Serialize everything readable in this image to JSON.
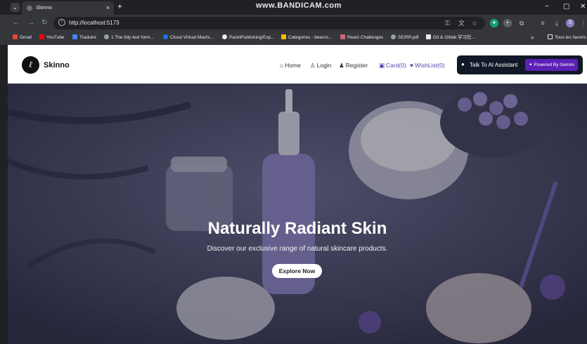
{
  "browser": {
    "tab_title": "Skinno",
    "tab_close": "×",
    "new_tab": "+",
    "watermark": "www.BANDICAM.com",
    "url": "http://localhost:5173",
    "window_controls": [
      "−",
      "▢",
      "✕"
    ],
    "bookmarks": [
      {
        "label": "Gmail",
        "icon": "gmail-icon",
        "color": "#ea4335"
      },
      {
        "label": "YouTube",
        "icon": "youtube-icon",
        "color": "#ff0000"
      },
      {
        "label": "Traduire",
        "icon": "translate-icon",
        "color": "#4285f4"
      },
      {
        "label": "1 The tidy text form...",
        "icon": "globe-icon",
        "color": "#9aa0a6"
      },
      {
        "label": "Cloud Virtual Machi...",
        "icon": "cloud-icon",
        "color": "#1a73e8"
      },
      {
        "label": "PacktPublishing/Exp...",
        "icon": "github-icon",
        "color": "#e8eaed"
      },
      {
        "label": "Categories - beecro...",
        "icon": "bee-icon",
        "color": "#fbbc04"
      },
      {
        "label": "React Challenges",
        "icon": "react-icon",
        "color": "#d0657c"
      },
      {
        "label": "SEIRP.pdf",
        "icon": "globe-icon",
        "color": "#9aa0a6"
      },
      {
        "label": "Git & Gitlab 学习社...",
        "icon": "bookmark-icon",
        "color": "#e8eaed"
      }
    ],
    "bookmarks_more": "»",
    "all_bookmarks": "Tous les favoris"
  },
  "navbar": {
    "brand": "Skinno",
    "links": [
      {
        "label": "Home",
        "icon": "home-icon"
      },
      {
        "label": "Login",
        "icon": "user-icon"
      },
      {
        "label": "Register",
        "icon": "user-plus-icon"
      },
      {
        "label": "Card(0)",
        "icon": "bag-icon"
      },
      {
        "label": "WishList(0)",
        "icon": "heart-icon"
      }
    ],
    "ai_button": "Talk To AI Assistant",
    "ai_badge": "Powered By Gemini"
  },
  "hero": {
    "title": "Naturally Radiant Skin",
    "subtitle": "Discover our exclusive range of natural skincare products.",
    "cta": "Explore Now"
  },
  "colors": {
    "accent": "#5b21b6",
    "nav_purple": "#5b3fb0",
    "hero_bg": "#3a3a55"
  }
}
